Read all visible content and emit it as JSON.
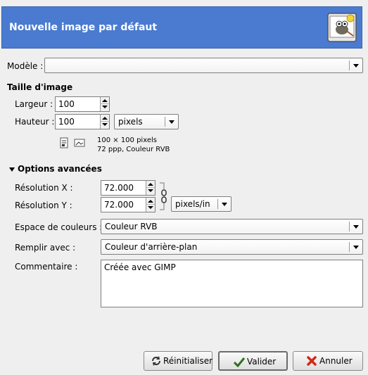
{
  "header": {
    "title": "Nouvelle image par défaut",
    "icon": "gimp-wilber-icon"
  },
  "template": {
    "label": "Modèle :",
    "value": ""
  },
  "image_size": {
    "title": "Taille d'image",
    "width_label": "Largeur :",
    "width_value": "100",
    "height_label": "Hauteur :",
    "height_value": "100",
    "unit": "pixels",
    "info_line1": "100 × 100 pixels",
    "info_line2": "72 ppp, Couleur RVB"
  },
  "advanced": {
    "title": "Options avancées",
    "res_x_label": "Résolution X :",
    "res_x_value": "72.000",
    "res_y_label": "Résolution Y :",
    "res_y_value": "72.000",
    "res_unit": "pixels/in",
    "colorspace_label": "Espace de couleurs :",
    "colorspace_value": "Couleur RVB",
    "fill_label": "Remplir avec :",
    "fill_value": "Couleur d'arrière-plan",
    "comment_label": "Commentaire :",
    "comment_value": "Créée avec GIMP"
  },
  "buttons": {
    "reset": "Réinitialiser",
    "ok": "Valider",
    "cancel": "Annuler"
  },
  "colors": {
    "header_bg": "#4a7bd0",
    "window_bg": "#efefef"
  }
}
